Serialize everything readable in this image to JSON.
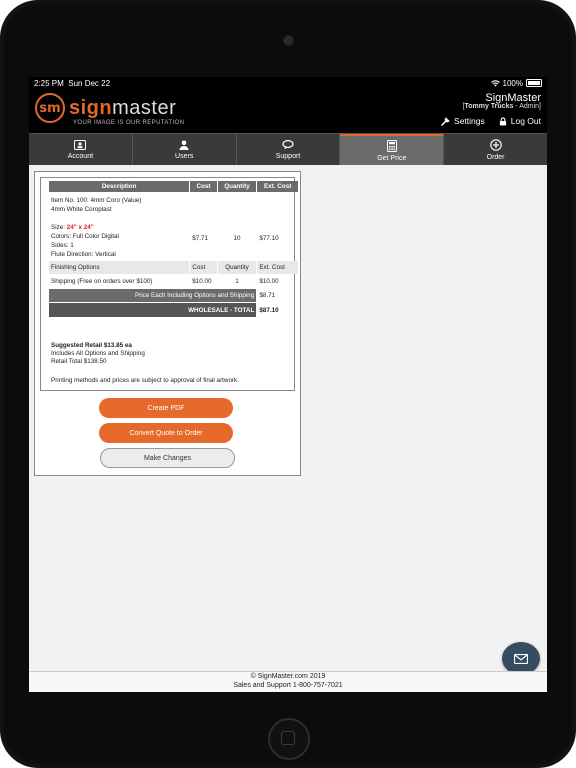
{
  "status": {
    "time": "2:25 PM",
    "date": "Sun Dec 22",
    "battery": "100%"
  },
  "brand": {
    "badge": "sm",
    "name_a": "sign",
    "name_b": "master",
    "tagline": "YOUR IMAGE IS OUR REPUTATION"
  },
  "account": {
    "company": "SignMaster",
    "user": "Tommy Trucks",
    "role": " - Admin",
    "settings": "Settings",
    "logout": "Log Out"
  },
  "nav": [
    {
      "label": "Account",
      "icon": "account-icon"
    },
    {
      "label": "Users",
      "icon": "users-icon"
    },
    {
      "label": "Support",
      "icon": "support-icon"
    },
    {
      "label": "Get Price",
      "icon": "calculator-icon",
      "active": true
    },
    {
      "label": "Order",
      "icon": "plus-circle-icon"
    }
  ],
  "quote": {
    "headers": {
      "description": "Description",
      "cost": "Cost",
      "quantity": "Quantity",
      "ext_cost": "Ext. Cost"
    },
    "item": {
      "line1": "Item No. 100: 4mm Coro (Value)",
      "line2": "4mm White Coroplast",
      "size_label": "Size:",
      "size_value": "24\" x 24\"",
      "colors": "Colors: Full Color Digital",
      "sides": "Sides: 1",
      "flute": "Flute Direction: Vertical",
      "cost": "$7.71",
      "quantity": "10",
      "ext_cost": "$77.10"
    },
    "finishing_headers": {
      "label": "Finishing Options",
      "cost": "Cost",
      "quantity": "Quantity",
      "ext_cost": "Ext. Cost"
    },
    "shipping": {
      "label": "Shipping (Free on orders over $100)",
      "cost": "$10.00",
      "quantity": "1",
      "ext_cost": "$10.00"
    },
    "price_each": {
      "label": "Price Each Including Options and Shipping",
      "value": "$8.71"
    },
    "wholesale": {
      "label": "WHOLESALE - TOTAL",
      "value": "$87.10"
    },
    "retail": {
      "heading": "Suggested Retail $13.85 ea",
      "line1": "Includes All Options and Shipping",
      "line2": "Retail Total $138.50"
    },
    "disclaimer": "Printing methods and prices are subject to approval of final artwork."
  },
  "buttons": {
    "create_pdf": "Create PDF",
    "convert": "Convert Quote to Order",
    "make_changes": "Make Changes"
  },
  "footer": {
    "line1": "© SignMaster.com 2019",
    "line2": "Sales and Support 1-800-757-7021"
  },
  "colors": {
    "accent": "#e5692a",
    "header_bg": "#000000",
    "nav_bg": "#3a3a3a",
    "nav_active": "#6b6b6b",
    "chat_bg": "#364c61"
  }
}
